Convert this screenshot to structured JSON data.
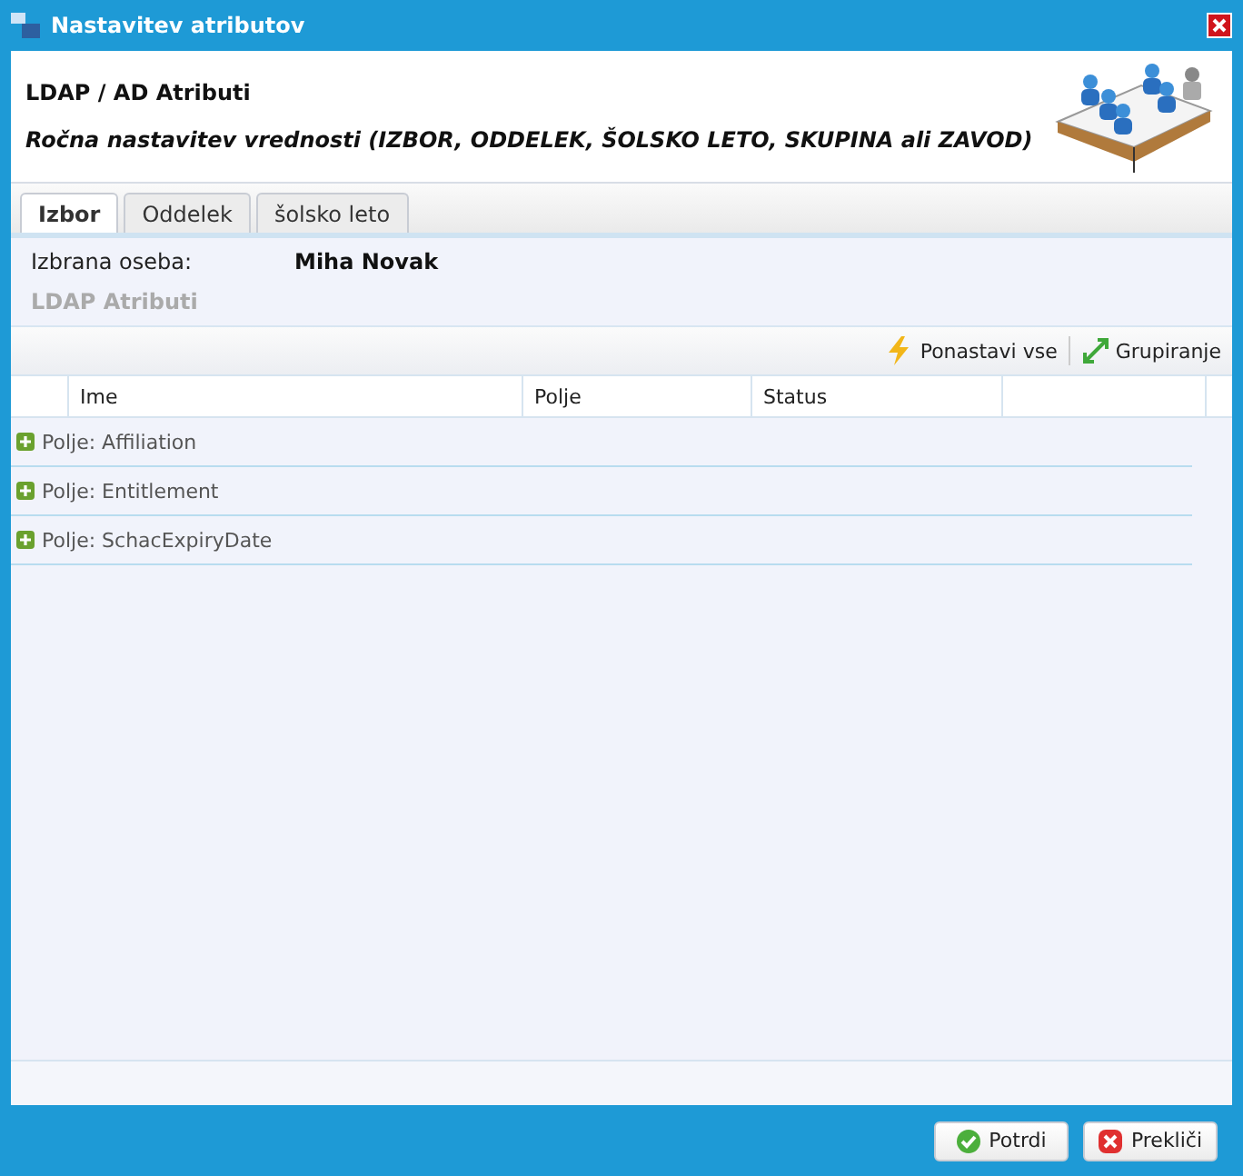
{
  "window": {
    "title": "Nastavitev atributov"
  },
  "header": {
    "title": "LDAP / AD Atributi",
    "subtitle": "Ročna nastavitev vrednosti (IZBOR, ODDELEK, ŠOLSKO LETO, SKUPINA ali ZAVOD)"
  },
  "tabs": [
    {
      "label": "Izbor",
      "selected": true
    },
    {
      "label": "Oddelek",
      "selected": false
    },
    {
      "label": "šolsko leto",
      "selected": false
    }
  ],
  "selection": {
    "label": "Izbrana oseba:",
    "value": "Miha Novak",
    "section_title": "LDAP Atributi"
  },
  "toolbar": [
    "Ponastavi vse",
    "Grupiranje"
  ],
  "table": {
    "columns": [
      "Ime",
      "Polje",
      "Status"
    ],
    "groups": [
      {
        "label": "Polje: Affiliation",
        "expanded": false
      },
      {
        "label": "Polje: Entitlement",
        "expanded": false
      },
      {
        "label": "Polje: SchacExpiryDate",
        "expanded": false
      }
    ]
  },
  "buttons": [
    "Potrdi",
    "Prekliči"
  ]
}
